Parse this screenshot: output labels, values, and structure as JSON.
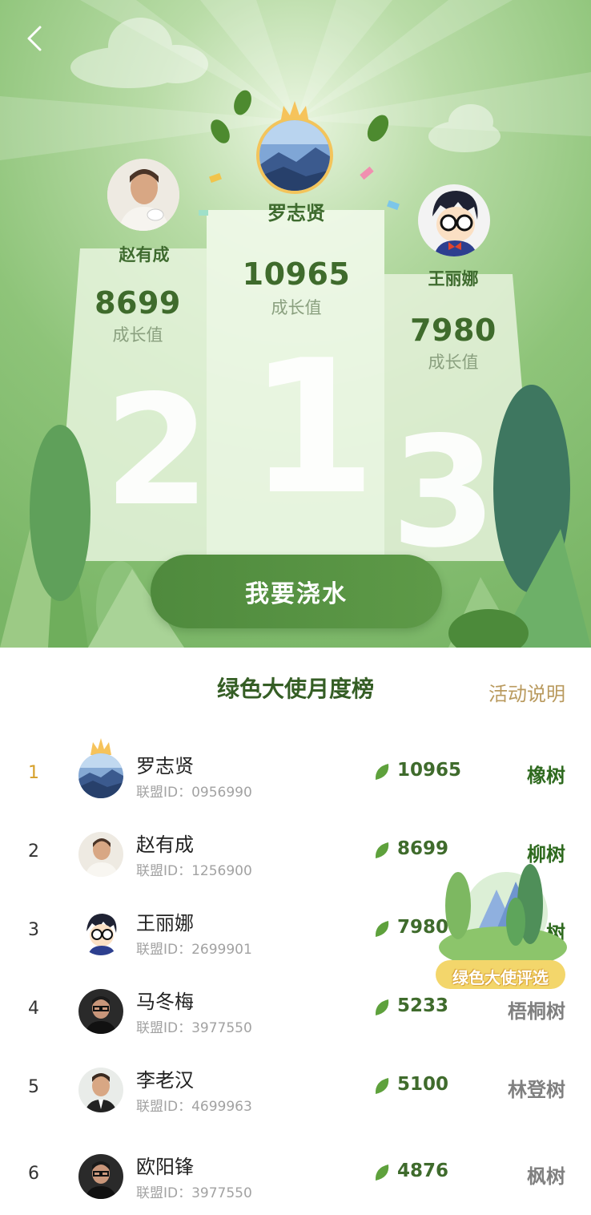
{
  "podium": {
    "first": {
      "name": "罗志贤",
      "score": "10965",
      "unit": "成长值",
      "rank": "1"
    },
    "second": {
      "name": "赵有成",
      "score": "8699",
      "unit": "成长值",
      "rank": "2"
    },
    "third": {
      "name": "王丽娜",
      "score": "7980",
      "unit": "成长值",
      "rank": "3"
    }
  },
  "water_button": "我要浇水",
  "board": {
    "title": "绿色大使月度榜",
    "rules_link": "活动说明",
    "badge_text": "绿色大使评选",
    "rows": [
      {
        "rank": "1",
        "name": "罗志贤",
        "uid": "联盟ID：0956990",
        "value": "10965",
        "tree": "橡树",
        "tree_color": "#2f6a1f"
      },
      {
        "rank": "2",
        "name": "赵有成",
        "uid": "联盟ID：1256900",
        "value": "8699",
        "tree": "柳树",
        "tree_color": "#2f6a1f"
      },
      {
        "rank": "3",
        "name": "王丽娜",
        "uid": "联盟ID：2699901",
        "value": "7980",
        "tree": "树",
        "tree_color": "#2f6a1f"
      },
      {
        "rank": "4",
        "name": "马冬梅",
        "uid": "联盟ID：3977550",
        "value": "5233",
        "tree": "梧桐树",
        "tree_color": "#808080"
      },
      {
        "rank": "5",
        "name": "李老汉",
        "uid": "联盟ID：4699963",
        "value": "5100",
        "tree": "林登树",
        "tree_color": "#808080"
      },
      {
        "rank": "6",
        "name": "欧阳锋",
        "uid": "联盟ID：3977550",
        "value": "4876",
        "tree": "枫树",
        "tree_color": "#808080"
      }
    ]
  },
  "colors": {
    "brand_green": "#4f8a3d",
    "gold": "#d6a02a",
    "link": "#b99a5e"
  }
}
